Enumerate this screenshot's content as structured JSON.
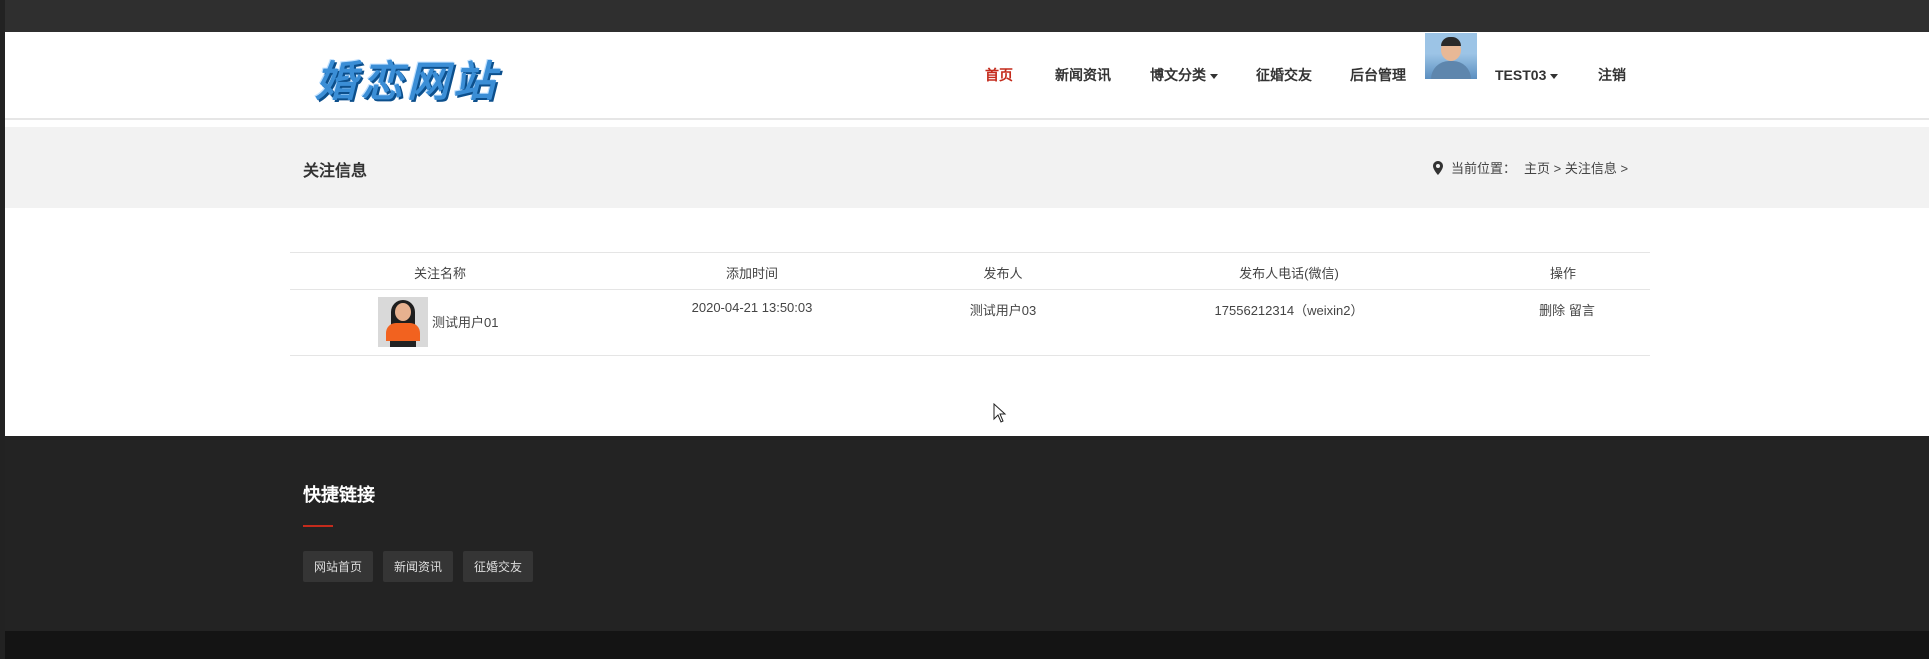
{
  "header": {
    "logo_text": "婚恋网站",
    "nav": [
      {
        "label": "首页"
      },
      {
        "label": "新闻资讯"
      },
      {
        "label": "博文分类"
      },
      {
        "label": "征婚交友"
      },
      {
        "label": "后台管理"
      }
    ],
    "username": "TEST03",
    "logout": "注销"
  },
  "banner": {
    "title": "关注信息",
    "location_label": "当前位置：",
    "crumbs": "主页 > 关注信息 >"
  },
  "table": {
    "headers": [
      "关注名称",
      "添加时间",
      "发布人",
      "发布人电话(微信)",
      "操作"
    ],
    "rows": [
      {
        "name": "测试用户01",
        "time": "2020-04-21 13:50:03",
        "publisher": "测试用户03",
        "phone": "17556212314（weixin2）",
        "delete": "删除",
        "message": "留言"
      }
    ]
  },
  "footer": {
    "title": "快捷链接",
    "links": [
      "网站首页",
      "新闻资讯",
      "征婚交友"
    ]
  },
  "colors": {
    "accent": "#c42b1c",
    "topbar": "#2f2f2f",
    "footer": "#232323"
  }
}
